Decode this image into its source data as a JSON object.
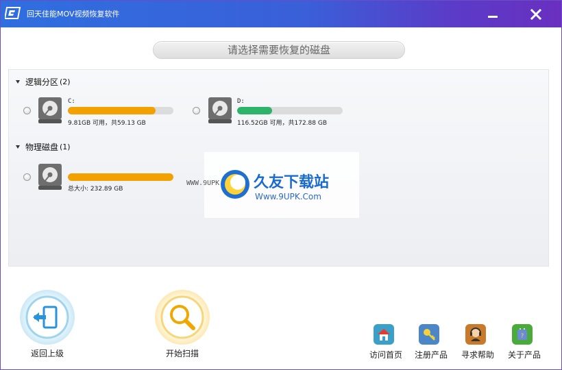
{
  "window": {
    "title": "回天佳能MOV视频恢复软件",
    "minimize_glyph": "—",
    "close_glyph": "✕"
  },
  "header": {
    "title": "请选择需要恢复的磁盘"
  },
  "groups": [
    {
      "label": "逻辑分区",
      "count": "(2)"
    },
    {
      "label": "物理磁盘",
      "count": "(1)"
    }
  ],
  "drives": [
    {
      "name": "C:",
      "info": "9.81GB 可用，共59.13 GB",
      "used_fraction": 0.83,
      "color": "#f2a100",
      "icon": "hard-drive-icon"
    },
    {
      "name": "D:",
      "info": "116.52GB 可用，共172.88 GB",
      "used_fraction": 0.33,
      "color": "#2eb46a",
      "icon": "hard-drive-icon"
    },
    {
      "name": "",
      "info": "总大小: 232.89 GB",
      "used_fraction": 1.0,
      "color": "#f2a100",
      "icon": "hard-drive-icon"
    }
  ],
  "watermark": {
    "url_text": "WWW.9UPK.COM",
    "brand": "久友下载站",
    "site": "Www.9UPK.Com"
  },
  "actions": {
    "back_label": "返回上级",
    "scan_label": "开始扫描"
  },
  "tools": [
    {
      "label": "访问首页",
      "icon": "home-icon",
      "color": "#3aa0c8"
    },
    {
      "label": "注册产品",
      "icon": "key-icon",
      "color": "#4a86c8"
    },
    {
      "label": "寻求帮助",
      "icon": "support-icon",
      "color": "#c87a2a"
    },
    {
      "label": "关于产品",
      "icon": "info-icon",
      "color": "#4aaa3a"
    }
  ],
  "colors": {
    "titlebar_start": "#2f6fe0",
    "titlebar_end": "#6a2fc0",
    "orange": "#f2a100",
    "green": "#2eb46a"
  }
}
